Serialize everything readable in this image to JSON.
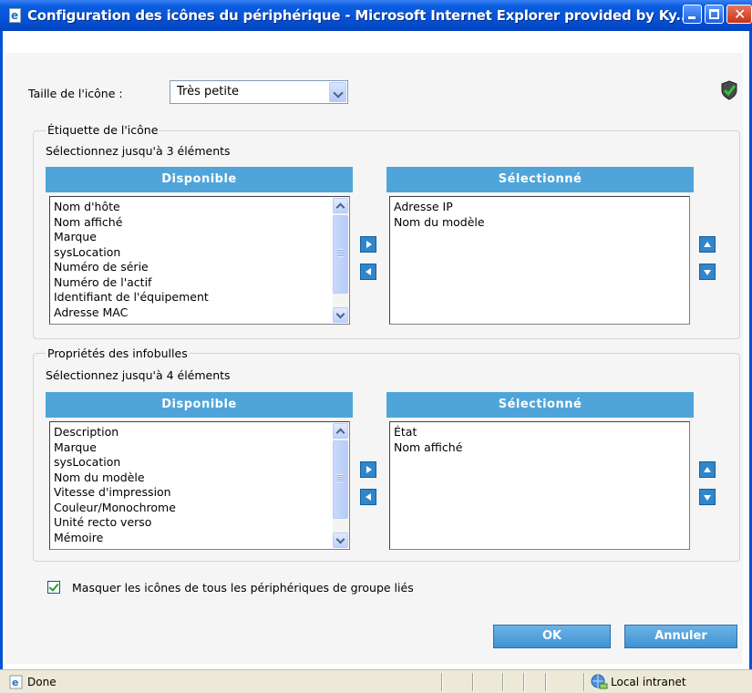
{
  "window": {
    "title": "Configuration des icônes du périphérique - Microsoft Internet Explorer provided by Ky..."
  },
  "icon_size": {
    "label": "Taille de l'icône :",
    "value": "Très petite"
  },
  "icon_label_group": {
    "legend": "Étiquette de l'icône",
    "hint": "Sélectionnez jusqu'à 3 éléments",
    "available_header": "Disponible",
    "selected_header": "Sélectionné",
    "available_items": [
      "Nom d'hôte",
      "Nom affiché",
      "Marque",
      "sysLocation",
      "Numéro de série",
      "Numéro de l'actif",
      "Identifiant de l'équipement",
      "Adresse MAC"
    ],
    "selected_items": [
      "Adresse IP",
      "Nom du modèle"
    ]
  },
  "tooltip_group": {
    "legend": "Propriétés des infobulles",
    "hint": "Sélectionnez jusqu'à 4 éléments",
    "available_header": "Disponible",
    "selected_header": "Sélectionné",
    "available_items": [
      "Description",
      "Marque",
      "sysLocation",
      "Nom du modèle",
      "Vitesse d'impression",
      "Couleur/Monochrome",
      "Unité recto verso",
      "Mémoire"
    ],
    "selected_items": [
      "État",
      "Nom affiché"
    ]
  },
  "hide_linked": {
    "checked": true,
    "label": "Masquer les icônes de tous les périphériques de groupe liés"
  },
  "buttons": {
    "ok": "OK",
    "cancel": "Annuler"
  },
  "status_bar": {
    "status": "Done",
    "zone": "Local intranet"
  },
  "colors": {
    "header_blue": "#4fa5d9",
    "button_blue": "#3f93d2",
    "titlebar_blue": "#0553d6"
  }
}
